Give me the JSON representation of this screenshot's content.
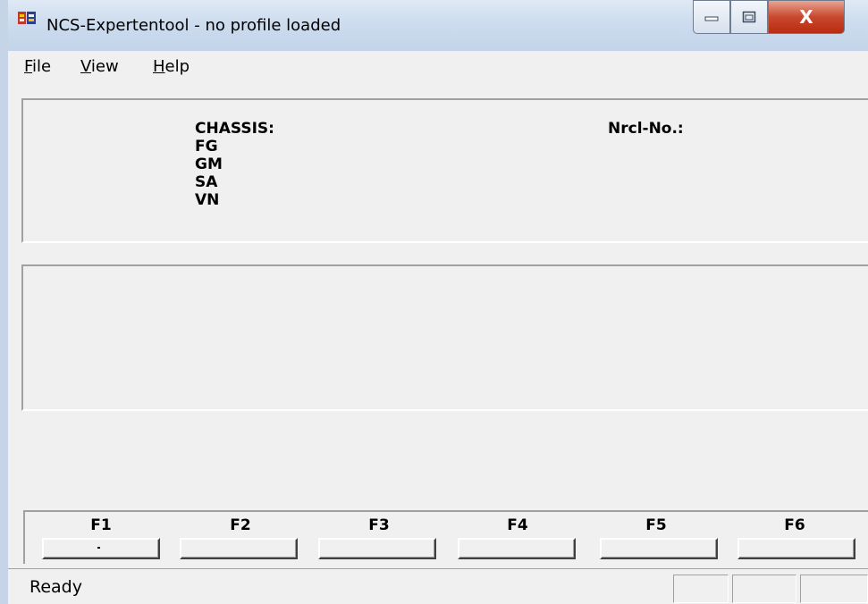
{
  "window": {
    "title": "NCS-Expertentool - no profile loaded",
    "close_glyph": "X"
  },
  "menu": {
    "items": [
      {
        "label": "File"
      },
      {
        "label": "View"
      },
      {
        "label": "Help"
      }
    ]
  },
  "info": {
    "chassis_label": "CHASSIS:",
    "fg_label": "FG",
    "gm_label": "GM",
    "sa_label": "SA",
    "vn_label": "VN",
    "nrcl_label": "Nrcl-No.:"
  },
  "function_keys": [
    {
      "label": "F1"
    },
    {
      "label": "F2"
    },
    {
      "label": "F3"
    },
    {
      "label": "F4"
    },
    {
      "label": "F5"
    },
    {
      "label": "F6"
    }
  ],
  "status": {
    "text": "Ready"
  },
  "icons": {
    "app": "app-icon",
    "minimize": "minimize-icon",
    "maximize": "maximize-icon",
    "close": "close-icon"
  },
  "colors": {
    "title_bar": "#cddcee",
    "close_button": "#c9482e",
    "window_bg": "#f0f0f0"
  }
}
